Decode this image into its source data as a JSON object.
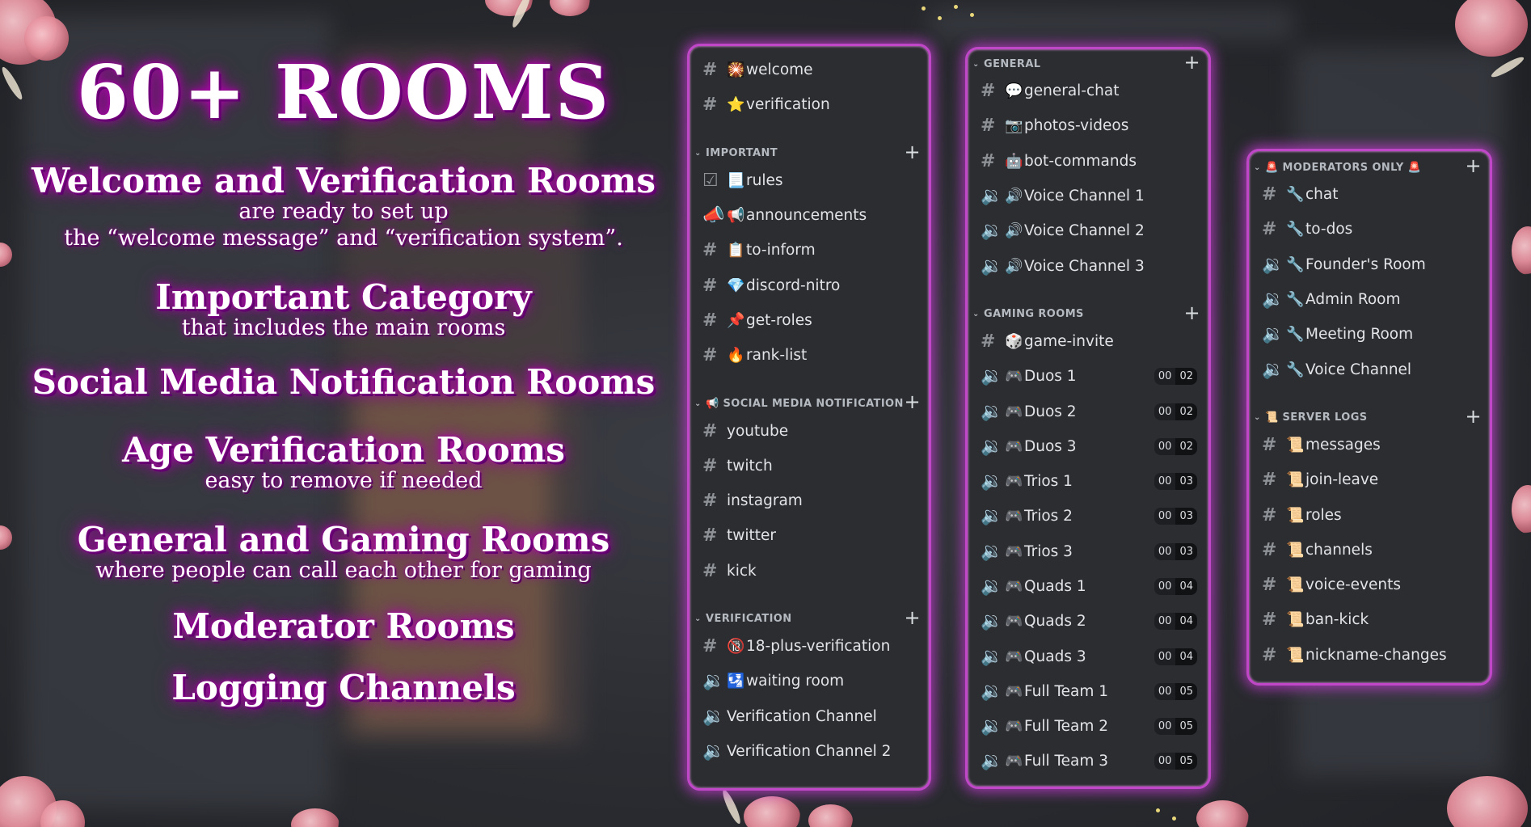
{
  "promo": {
    "title": "60+ ROOMS",
    "features": [
      {
        "heading": "Welcome and Verification Rooms",
        "lines": [
          "are ready to set up",
          "the “welcome message” and “verification system”."
        ]
      },
      {
        "heading": "Important Category",
        "lines": [
          "that includes the main rooms"
        ]
      },
      {
        "heading": "Social Media Notification Rooms",
        "lines": []
      },
      {
        "heading": "Age Verification Rooms",
        "lines": [
          "easy to remove if needed"
        ]
      },
      {
        "heading": "General and Gaming Rooms",
        "lines": [
          "where people can call each other for gaming"
        ]
      },
      {
        "heading": "Moderator Rooms",
        "lines": []
      },
      {
        "heading": "Logging Channels",
        "lines": []
      }
    ]
  },
  "panels": [
    {
      "id": "panel-1",
      "sections": [
        {
          "category": "",
          "channels": [
            {
              "type": "text",
              "icon": "🎇",
              "name": "welcome"
            },
            {
              "type": "text",
              "icon": "⭐",
              "name": "verification"
            }
          ]
        },
        {
          "category": "IMPORTANT",
          "channels": [
            {
              "type": "rules",
              "icon": "📃",
              "name": "rules"
            },
            {
              "type": "announce",
              "icon": "📢",
              "name": "announcements"
            },
            {
              "type": "text",
              "icon": "📋",
              "name": "to-inform"
            },
            {
              "type": "text",
              "icon": "💎",
              "name": "discord-nitro"
            },
            {
              "type": "text",
              "icon": "📌",
              "name": "get-roles"
            },
            {
              "type": "text",
              "icon": "🔥",
              "name": "rank-list"
            }
          ]
        },
        {
          "category": "📢 SOCIAL MEDIA NOTIFICATION",
          "channels": [
            {
              "type": "text",
              "icon": "",
              "name": "youtube"
            },
            {
              "type": "text",
              "icon": "",
              "name": "twitch"
            },
            {
              "type": "text",
              "icon": "",
              "name": "instagram"
            },
            {
              "type": "text",
              "icon": "",
              "name": "twitter"
            },
            {
              "type": "text",
              "icon": "",
              "name": "kick"
            }
          ]
        },
        {
          "category": "VERIFICATION",
          "channels": [
            {
              "type": "text",
              "icon": "🔞",
              "name": "18-plus-verification"
            },
            {
              "type": "voice",
              "icon": "🛂",
              "name": "waiting room"
            },
            {
              "type": "voice",
              "icon": "",
              "name": "Verification Channel"
            },
            {
              "type": "voice",
              "icon": "",
              "name": "Verification Channel 2"
            }
          ]
        }
      ]
    },
    {
      "id": "panel-2",
      "sections": [
        {
          "category": "GENERAL",
          "channels": [
            {
              "type": "text",
              "icon": "💬",
              "name": "general-chat"
            },
            {
              "type": "text",
              "icon": "📷",
              "name": "photos-videos"
            },
            {
              "type": "text",
              "icon": "🤖",
              "name": "bot-commands"
            },
            {
              "type": "voice",
              "icon": "🔊",
              "name": "Voice Channel 1"
            },
            {
              "type": "voice",
              "icon": "🔊",
              "name": "Voice Channel 2"
            },
            {
              "type": "voice",
              "icon": "🔊",
              "name": "Voice Channel 3"
            }
          ]
        },
        {
          "category": "GAMING ROOMS",
          "channels": [
            {
              "type": "text",
              "icon": "🎲",
              "name": "game-invite"
            },
            {
              "type": "voice",
              "icon": "🎮",
              "name": "Duos 1",
              "badge": [
                "00",
                "02"
              ]
            },
            {
              "type": "voice",
              "icon": "🎮",
              "name": "Duos 2",
              "badge": [
                "00",
                "02"
              ]
            },
            {
              "type": "voice",
              "icon": "🎮",
              "name": "Duos 3",
              "badge": [
                "00",
                "02"
              ]
            },
            {
              "type": "voice",
              "icon": "🎮",
              "name": "Trios 1",
              "badge": [
                "00",
                "03"
              ]
            },
            {
              "type": "voice",
              "icon": "🎮",
              "name": "Trios 2",
              "badge": [
                "00",
                "03"
              ]
            },
            {
              "type": "voice",
              "icon": "🎮",
              "name": "Trios 3",
              "badge": [
                "00",
                "03"
              ]
            },
            {
              "type": "voice",
              "icon": "🎮",
              "name": "Quads 1",
              "badge": [
                "00",
                "04"
              ]
            },
            {
              "type": "voice",
              "icon": "🎮",
              "name": "Quads 2",
              "badge": [
                "00",
                "04"
              ]
            },
            {
              "type": "voice",
              "icon": "🎮",
              "name": "Quads 3",
              "badge": [
                "00",
                "04"
              ]
            },
            {
              "type": "voice",
              "icon": "🎮",
              "name": "Full Team 1",
              "badge": [
                "00",
                "05"
              ]
            },
            {
              "type": "voice",
              "icon": "🎮",
              "name": "Full Team 2",
              "badge": [
                "00",
                "05"
              ]
            },
            {
              "type": "voice",
              "icon": "🎮",
              "name": "Full Team 3",
              "badge": [
                "00",
                "05"
              ]
            }
          ]
        }
      ]
    },
    {
      "id": "panel-3",
      "sections": [
        {
          "category": "🚨 MODERATORS ONLY 🚨",
          "channels": [
            {
              "type": "text",
              "icon": "🔧",
              "name": "chat"
            },
            {
              "type": "text",
              "icon": "🔧",
              "name": "to-dos"
            },
            {
              "type": "voice",
              "icon": "🔧",
              "name": "Founder's Room"
            },
            {
              "type": "voice",
              "icon": "🔧",
              "name": "Admin Room"
            },
            {
              "type": "voice",
              "icon": "🔧",
              "name": "Meeting Room"
            },
            {
              "type": "voice",
              "icon": "🔧",
              "name": "Voice Channel"
            }
          ]
        },
        {
          "category": "📜 SERVER LOGS",
          "channels": [
            {
              "type": "text",
              "icon": "📜",
              "name": "messages"
            },
            {
              "type": "text",
              "icon": "📜",
              "name": "join-leave"
            },
            {
              "type": "text",
              "icon": "📜",
              "name": "roles"
            },
            {
              "type": "text",
              "icon": "📜",
              "name": "channels"
            },
            {
              "type": "text",
              "icon": "📜",
              "name": "voice-events"
            },
            {
              "type": "text",
              "icon": "📜",
              "name": "ban-kick"
            },
            {
              "type": "text",
              "icon": "📜",
              "name": "nickname-changes"
            }
          ]
        }
      ]
    }
  ],
  "colors": {
    "panel_border": "#c048c8",
    "panel_bg": "#2b2d31",
    "glow": "#c400c0"
  }
}
